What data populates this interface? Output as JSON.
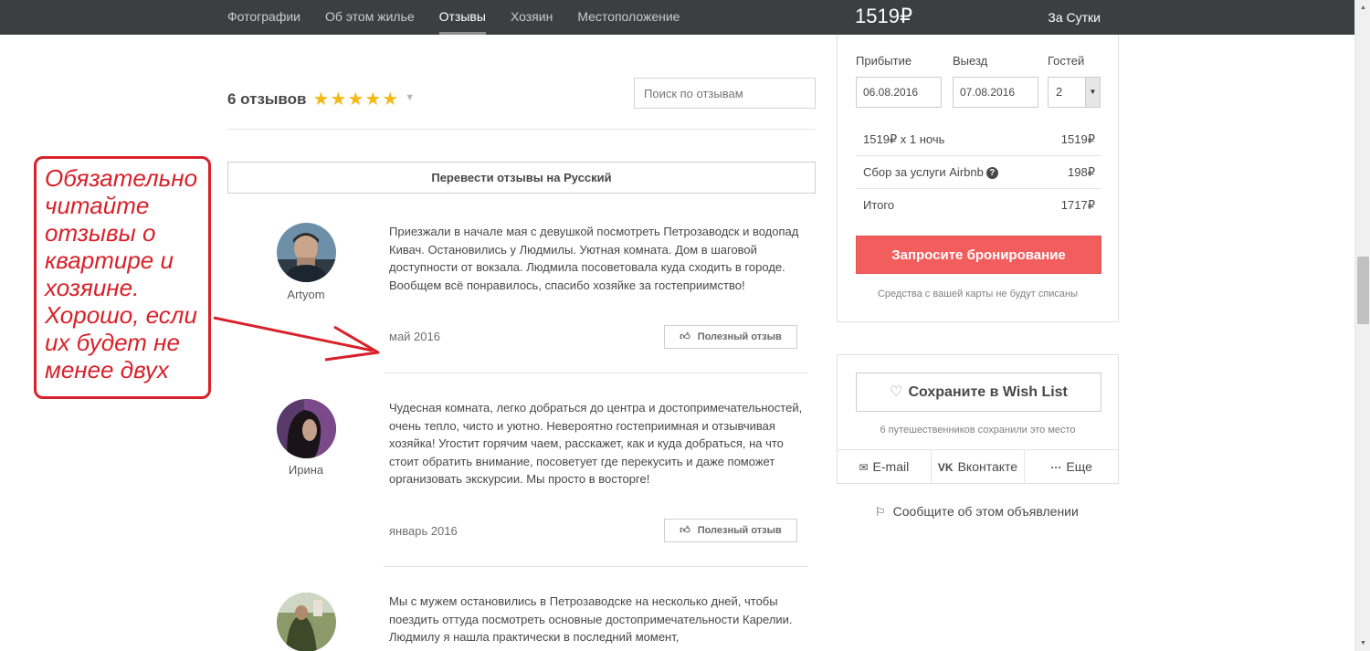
{
  "nav": {
    "tabs": [
      {
        "label": "Фотографии"
      },
      {
        "label": "Об этом жилье"
      },
      {
        "label": "Отзывы"
      },
      {
        "label": "Хозяин"
      },
      {
        "label": "Местоположение"
      }
    ],
    "active_tab": "Отзывы"
  },
  "price_header": {
    "amount": "1519₽",
    "per": "За Сутки"
  },
  "reviews": {
    "count_label": "6 отзывов",
    "rating": 5,
    "search_placeholder": "Поиск по отзывам",
    "translate_label": "Перевести отзывы на Русский",
    "helpful_label": "Полезный отзыв",
    "items": [
      {
        "name": "Artyom",
        "text": "Приезжали в начале мая с девушкой посмотреть Петрозаводск и водопад Кивач. Остановились у Людмилы. Уютная комната. Дом в шаговой доступности от вокзала. Людмила посоветовала куда сходить в городе. Вообщем всё понравилось, спасибо хозяйке за гостеприимство!",
        "date": "май 2016"
      },
      {
        "name": "Ирина",
        "text": "Чудесная комната, легко добраться до центра и достопримечательностей, очень тепло, чисто и уютно. Невероятно гостеприимная и отзывчивая хозяйка! Угостит горячим чаем, расскажет, как и куда добраться, на что стоит обратить внимание, посоветует где перекусить и даже поможет организовать экскурсии. Мы просто в восторге!",
        "date": "январь 2016"
      },
      {
        "name": "",
        "text": "Мы с мужем остановились в Петрозаводске на несколько дней, чтобы поездить оттуда посмотреть основные достопримечательности Карелии. Людмилу я нашла практически в последний момент,",
        "date": ""
      }
    ]
  },
  "booking": {
    "arrival_label": "Прибытие",
    "arrival_value": "06.08.2016",
    "departure_label": "Выезд",
    "departure_value": "07.08.2016",
    "guests_label": "Гостей",
    "guests_value": "2",
    "rows": [
      {
        "label": "1519₽ x 1 ночь",
        "value": "1519₽"
      },
      {
        "label": "Сбор за услуги Airbnb",
        "value": "198₽"
      },
      {
        "label": "Итого",
        "value": "1717₽"
      }
    ],
    "book_button": "Запросите бронирование",
    "note": "Средства с вашей карты не будут списаны"
  },
  "wishlist": {
    "button": "Сохраните в Wish List",
    "note": "6 путешественников сохранили это место",
    "share": [
      {
        "label": "E-mail",
        "icon": "envelope-icon"
      },
      {
        "label": "Вконтакте",
        "icon": "vk-icon"
      },
      {
        "label": "Еще",
        "icon": "more-icon"
      }
    ]
  },
  "report_label": "Сообщите об этом объявлении",
  "annotation": {
    "text": "Обязательно читайте отзывы о квартире и хозяине. Хорошо, если их будет не менее двух",
    "color": "#d8212a"
  },
  "colors": {
    "nav_bg": "#3c3f40",
    "star": "#f5b816",
    "book_button": "#f25e5e"
  }
}
